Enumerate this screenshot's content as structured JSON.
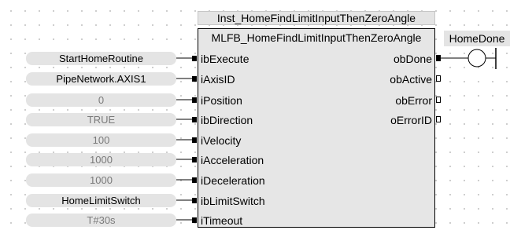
{
  "instance": {
    "name": "Inst_HomeFindLimitInputThenZeroAngle"
  },
  "block": {
    "type_name": "MLFB_HomeFindLimitInputThenZeroAngle",
    "inputs": [
      {
        "pin": "ibExecute",
        "variable": "StartHomeRoutine",
        "kind": "variable"
      },
      {
        "pin": "iAxisID",
        "variable": "PipeNetwork.AXIS1",
        "kind": "variable"
      },
      {
        "pin": "iPosition",
        "variable": "0",
        "kind": "constant"
      },
      {
        "pin": "ibDirection",
        "variable": "TRUE",
        "kind": "constant"
      },
      {
        "pin": "iVelocity",
        "variable": "100",
        "kind": "constant"
      },
      {
        "pin": "iAcceleration",
        "variable": "1000",
        "kind": "constant"
      },
      {
        "pin": "iDeceleration",
        "variable": "1000",
        "kind": "constant"
      },
      {
        "pin": "ibLimitSwitch",
        "variable": "HomeLimitSwitch",
        "kind": "variable"
      },
      {
        "pin": "iTimeout",
        "variable": "T#30s",
        "kind": "constant"
      }
    ],
    "outputs": [
      {
        "pin": "obDone",
        "connected": true
      },
      {
        "pin": "obActive",
        "connected": false
      },
      {
        "pin": "obError",
        "connected": false
      },
      {
        "pin": "oErrorID",
        "connected": false
      }
    ]
  },
  "coil": {
    "variable": "HomeDone"
  },
  "colors": {
    "block_fill": "#e6e6e6",
    "variable_fill": "#e4e4e4",
    "constant_text": "#7a7a7a",
    "wire": "#000000"
  }
}
